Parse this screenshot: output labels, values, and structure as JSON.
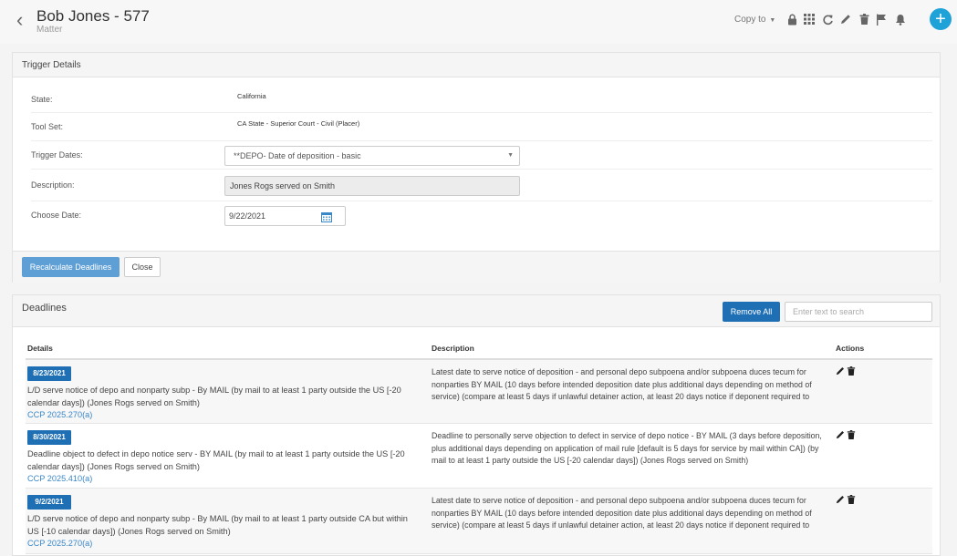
{
  "header": {
    "title": "Bob Jones - 577",
    "subtitle": "Matter",
    "copy_to_label": "Copy to",
    "accent_color": "#1ea2d8",
    "icons": [
      "lock-icon",
      "grid-icon",
      "refresh-icon",
      "pencil-icon",
      "trash-icon",
      "flag-icon",
      "bell-icon",
      "plus-icon"
    ]
  },
  "trigger_details": {
    "heading": "Trigger Details",
    "state_label": "State:",
    "state_value": "California",
    "toolset_label": "Tool Set:",
    "toolset_value": "CA State - Superior Court - Civil (Placer)",
    "trigger_dates_label": "Trigger Dates:",
    "trigger_dates_value": "**DEPO- Date of deposition - basic",
    "description_label": "Description:",
    "description_value": "Jones Rogs served on Smith",
    "choose_date_label": "Choose Date:",
    "choose_date_value": "9/22/2021",
    "recalculate_label": "Recalculate Deadlines",
    "close_label": "Close"
  },
  "deadlines": {
    "heading": "Deadlines",
    "remove_all_label": "Remove All",
    "search_placeholder": "Enter text to search",
    "columns": {
      "details": "Details",
      "description": "Description",
      "actions": "Actions"
    },
    "rows": [
      {
        "date": "8/23/2021",
        "details": "L/D serve notice of depo and nonparty subp - By MAIL (by mail to at least 1 party outside the US [-20 calendar days]) (Jones Rogs served on Smith)",
        "rule": "CCP 2025.270(a)",
        "description": "Latest date to serve notice of deposition - and personal depo subpoena and/or subpoena duces tecum for nonparties BY MAIL (10 days before intended deposition date plus additional days depending on method of service) (compare at least 5 days if unlawful detainer action, at least 20 days notice if deponent required to produce consumer records, at least 20 days if deponent required to produce employment records) (by mail..."
      },
      {
        "date": "8/30/2021",
        "details": "Deadline object to defect in depo notice serv - BY MAIL (by mail to at least 1 party outside the US [-20 calendar days]) (Jones Rogs served on Smith)",
        "rule": "CCP 2025.410(a)",
        "description": "Deadline to personally serve objection to defect in service of depo notice - BY MAIL (3 days before deposition, plus additional days depending on application of mail rule [default is 5 days for service by mail within CA]) (by mail to at least 1 party outside the US [-20 calendar days]) (Jones Rogs served on Smith)"
      },
      {
        "date": "9/2/2021",
        "details": "L/D serve notice of depo and nonparty subp - By MAIL (by mail to at least 1 party outside CA but within US [-10 calendar days]) (Jones Rogs served on Smith)",
        "rule": "CCP 2025.270(a)",
        "description": "Latest date to serve notice of deposition - and personal depo subpoena and/or subpoena duces tecum for nonparties BY MAIL (10 days before intended deposition date plus additional days depending on method of service) (compare at least 5 days if unlawful detainer action, at least 20 days notice if deponent required to produce consumer records, at least 20 days if deponent required to produce employment records) (by mail..."
      }
    ]
  }
}
